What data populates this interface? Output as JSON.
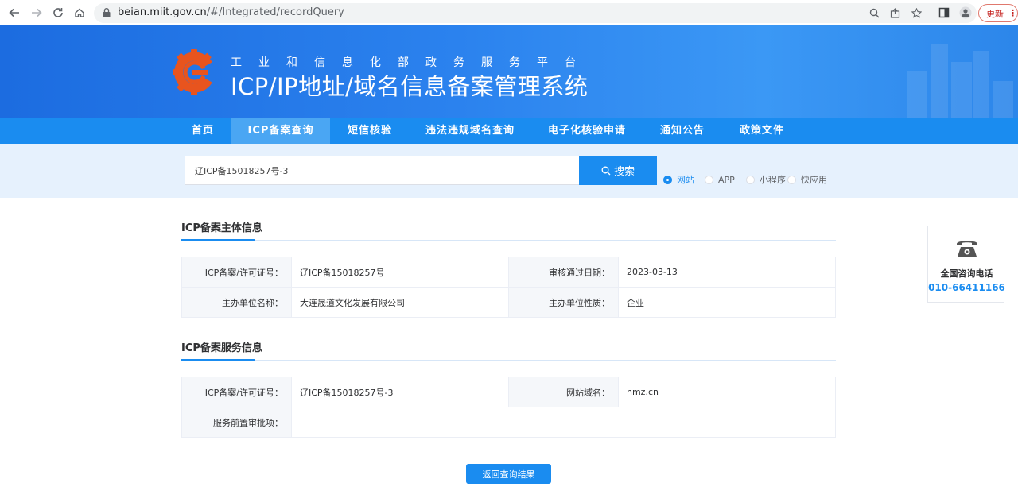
{
  "browser": {
    "url_host": "beian.miit.gov.cn",
    "url_path": "/#/Integrated/recordQuery",
    "update_label": "更新",
    "update_menu": "⋮"
  },
  "header": {
    "subtitle": "工业和信息化部政务服务平台",
    "title": "ICP/IP地址/域名信息备案管理系统"
  },
  "nav": {
    "items": [
      "首页",
      "ICP备案查询",
      "短信核验",
      "违法违规域名查询",
      "电子化核验申请",
      "通知公告",
      "政策文件"
    ],
    "active": "ICP备案查询"
  },
  "search": {
    "value": "辽ICP备15018257号-3",
    "button_label": "搜索",
    "options": [
      "网站",
      "APP",
      "小程序",
      "快应用"
    ],
    "selected": "网站"
  },
  "subject_info": {
    "title": "ICP备案主体信息",
    "rows": [
      [
        {
          "label": "ICP备案/许可证号：",
          "value": "辽ICP备15018257号"
        },
        {
          "label": "审核通过日期：",
          "value": "2023-03-13"
        }
      ],
      [
        {
          "label": "主办单位名称：",
          "value": "大连晟道文化发展有限公司"
        },
        {
          "label": "主办单位性质：",
          "value": "企业"
        }
      ]
    ]
  },
  "service_info": {
    "title": "ICP备案服务信息",
    "rows": [
      [
        {
          "label": "ICP备案/许可证号：",
          "value": "辽ICP备15018257号-3"
        },
        {
          "label": "网站域名：",
          "value": "hmz.cn"
        }
      ],
      [
        {
          "label": "服务前置审批项：",
          "value": ""
        }
      ]
    ]
  },
  "back_button": "返回查询结果",
  "contact": {
    "title": "全国咨询电话",
    "phone": "010-66411166"
  },
  "colors": {
    "primary": "#1a8cf0",
    "nav_active": "#4aa6f3",
    "search_bg": "#e6f1fd",
    "logo_orange": "#e8541e"
  }
}
